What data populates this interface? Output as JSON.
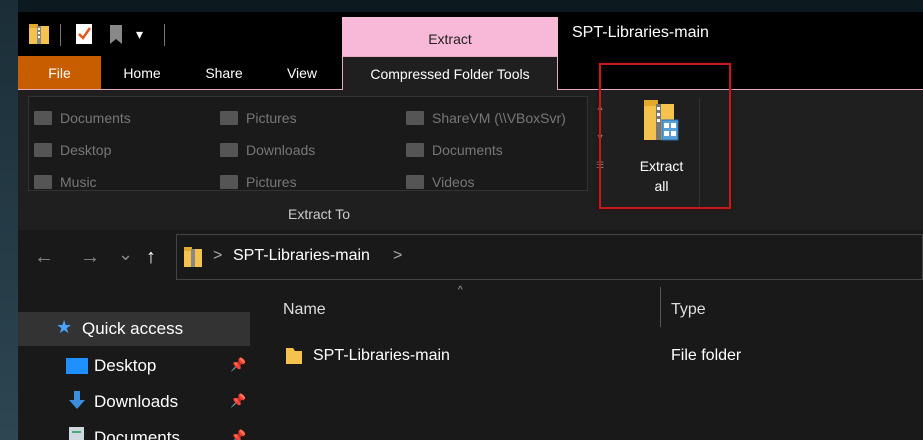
{
  "window": {
    "title": "SPT-Libraries-main"
  },
  "ribbon_tabs": {
    "file": "File",
    "home": "Home",
    "share": "Share",
    "view": "View",
    "context_header": "Extract",
    "context_tab": "Compressed Folder Tools"
  },
  "extract_to": {
    "group_label": "Extract To",
    "locations": [
      "Documents",
      "Pictures",
      "ShareVM (\\\\VBoxSvr)",
      "Desktop",
      "Downloads",
      "Documents",
      "Music",
      "Pictures",
      "Videos"
    ]
  },
  "extract_all": {
    "line1": "Extract",
    "line2": "all"
  },
  "address": {
    "path": "SPT-Libraries-main",
    "back": "←",
    "forward": "→",
    "recent": "⌄",
    "up": "↑",
    "separator": ">"
  },
  "nav_pane": {
    "quick_access": "Quick access",
    "items": [
      "Desktop",
      "Downloads",
      "Documents"
    ]
  },
  "file_list": {
    "columns": [
      "Name",
      "Type"
    ],
    "rows": [
      {
        "name": "SPT-Libraries-main",
        "type": "File folder"
      }
    ]
  },
  "colors": {
    "file_tab": "#c85d00",
    "context_tab": "#f7b9d7",
    "highlight": "#c41a1a",
    "folder": "#f4c24d"
  }
}
